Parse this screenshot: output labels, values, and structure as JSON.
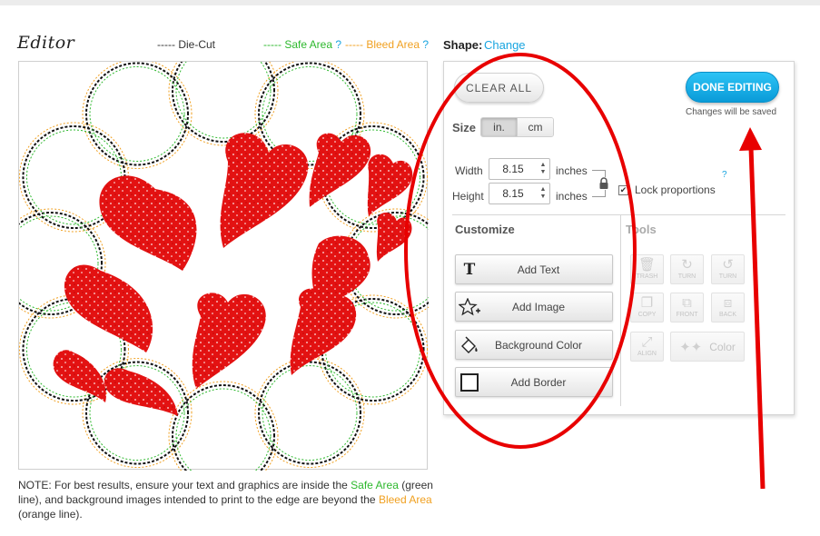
{
  "editor": {
    "title": "Editor",
    "legend": {
      "diecut": "----- Die-Cut",
      "safe": "----- Safe Area",
      "bleed": "----- Bleed Area",
      "help": "?"
    }
  },
  "note": {
    "prefix": "NOTE: For best results, ensure your text and graphics are inside the ",
    "safe": "Safe Area",
    "middle": " (green line), and background images intended to print to the edge are beyond the ",
    "bleed": "Bleed Area",
    "suffix": " (orange line)."
  },
  "shape": {
    "label": "Shape:",
    "link": "Change"
  },
  "panel": {
    "clear_all": "CLEAR ALL",
    "done_editing": "DONE EDITING",
    "saved_note": "Changes will be saved",
    "size": {
      "label": "Size",
      "units": [
        "in.",
        "cm"
      ],
      "active_unit": "in."
    },
    "width": {
      "label": "Width",
      "value": "8.15",
      "unit": "inches"
    },
    "height": {
      "label": "Height",
      "value": "8.15",
      "unit": "inches"
    },
    "lock": {
      "label": "Lock proportions",
      "checked": true,
      "check_glyph": "✔"
    },
    "help": "?",
    "customize": {
      "title": "Customize",
      "buttons": [
        {
          "label": "Add Text",
          "icon": "text-icon"
        },
        {
          "label": "Add Image",
          "icon": "star-plus-icon"
        },
        {
          "label": "Background Color",
          "icon": "paint-bucket-icon"
        },
        {
          "label": "Add Border",
          "icon": "square-border-icon"
        }
      ]
    },
    "tools": {
      "title": "Tools",
      "items": [
        {
          "label": "TRASH",
          "icon": "trash-icon"
        },
        {
          "label": "TURN",
          "icon": "rotate-right-icon"
        },
        {
          "label": "TURN",
          "icon": "rotate-left-icon"
        },
        {
          "label": "COPY",
          "icon": "copy-icon"
        },
        {
          "label": "FRONT",
          "icon": "bring-front-icon"
        },
        {
          "label": "BACK",
          "icon": "send-back-icon"
        },
        {
          "label": "ALIGN",
          "icon": "align-icon"
        },
        {
          "label": "Color",
          "icon": "color-stars-icon"
        }
      ]
    }
  },
  "colors": {
    "accent_blue": "#19a5e0",
    "safe_green": "#2db82d",
    "bleed_orange": "#f0a020",
    "heart_red": "#e01010",
    "annotation_red": "#e80000"
  }
}
